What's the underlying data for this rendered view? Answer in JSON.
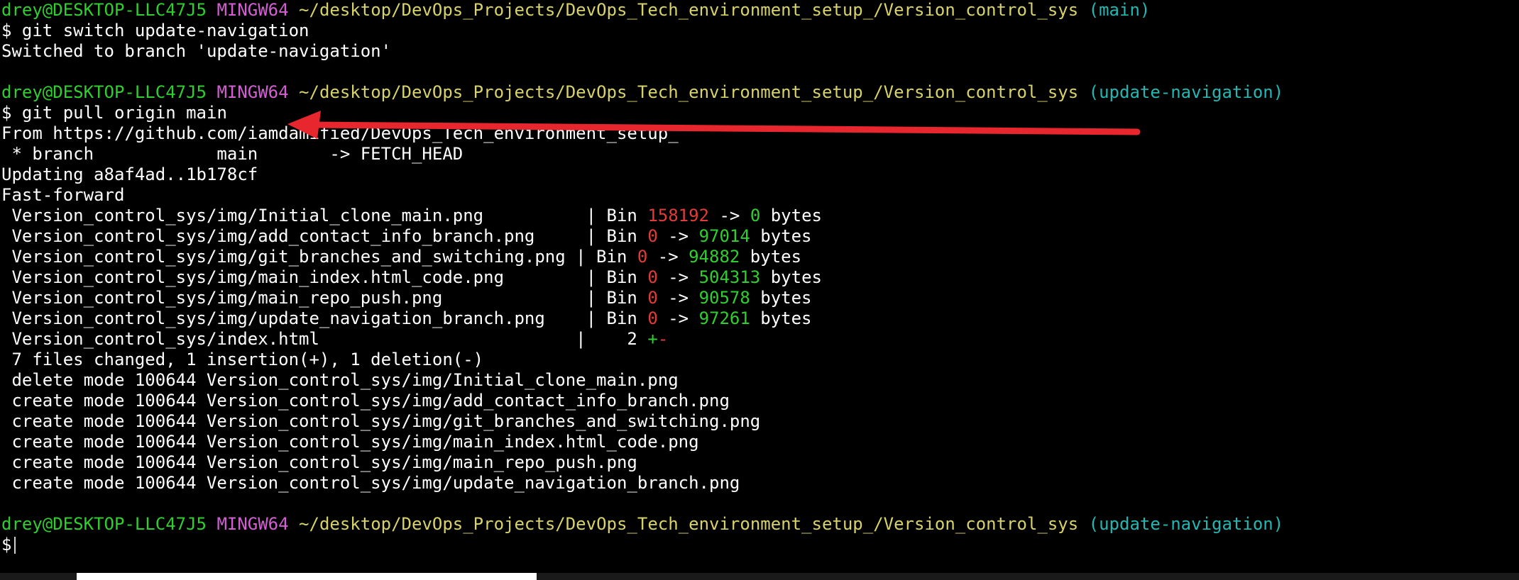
{
  "prompt": {
    "user_host": "drey@DESKTOP-LLC47J5",
    "shell": "MINGW64",
    "path": "~/desktop/DevOps_Projects/DevOps_Tech_environment_setup_/Version_control_sys",
    "branch_main": "(main)",
    "branch_update": "(update-navigation)",
    "symbol": "$"
  },
  "commands": {
    "switch": "git switch update-navigation",
    "pull": "git pull origin main"
  },
  "output": {
    "switched": "Switched to branch 'update-navigation'",
    "from": "From https://github.com/iamdamified/DevOps_Tech_environment_setup_",
    "fetch": " * branch            main       -> FETCH_HEAD",
    "updating": "Updating a8af4ad..1b178cf",
    "fastforward": "Fast-forward",
    "diffstat": [
      {
        "file": " Version_control_sys/img/Initial_clone_main.png          ",
        "pre": "| Bin ",
        "old": "158192",
        "mid": " -> ",
        "new": "0",
        "post": " bytes"
      },
      {
        "file": " Version_control_sys/img/add_contact_info_branch.png     ",
        "pre": "| Bin ",
        "old": "0",
        "mid": " -> ",
        "new": "97014",
        "post": " bytes"
      },
      {
        "file": " Version_control_sys/img/git_branches_and_switching.png ",
        "pre": "| Bin ",
        "old": "0",
        "mid": " -> ",
        "new": "94882",
        "post": " bytes"
      },
      {
        "file": " Version_control_sys/img/main_index.html_code.png        ",
        "pre": "| Bin ",
        "old": "0",
        "mid": " -> ",
        "new": "504313",
        "post": " bytes"
      },
      {
        "file": " Version_control_sys/img/main_repo_push.png              ",
        "pre": "| Bin ",
        "old": "0",
        "mid": " -> ",
        "new": "90578",
        "post": " bytes"
      },
      {
        "file": " Version_control_sys/img/update_navigation_branch.png    ",
        "pre": "| Bin ",
        "old": "0",
        "mid": " -> ",
        "new": "97261",
        "post": " bytes"
      }
    ],
    "index_line": {
      "file": " Version_control_sys/index.html                         ",
      "pre": "|    2 ",
      "plus": "+",
      "minus": "-"
    },
    "summary": " 7 files changed, 1 insertion(+), 1 deletion(-)",
    "modes": [
      " delete mode 100644 Version_control_sys/img/Initial_clone_main.png",
      " create mode 100644 Version_control_sys/img/add_contact_info_branch.png",
      " create mode 100644 Version_control_sys/img/git_branches_and_switching.png",
      " create mode 100644 Version_control_sys/img/main_index.html_code.png",
      " create mode 100644 Version_control_sys/img/main_repo_push.png",
      " create mode 100644 Version_control_sys/img/update_navigation_branch.png"
    ]
  },
  "colors": {
    "prompt_green": "#2fcf2f",
    "prompt_magenta": "#d35fd3",
    "path_yellow": "#d8d26a",
    "branch_cyan": "#22b7b2",
    "deleted_red": "#e23b3b",
    "annotation_arrow": "#e8262e"
  }
}
